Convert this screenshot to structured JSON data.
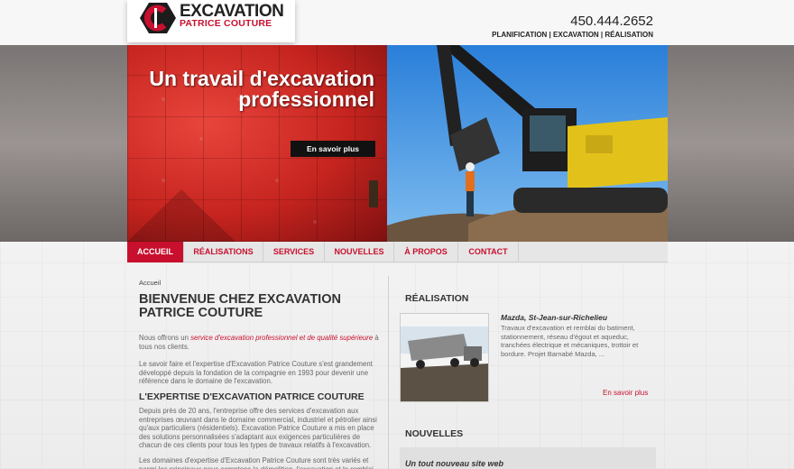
{
  "header": {
    "logo_line1": "EXCAVATION",
    "logo_line2": "PATRICE COUTURE",
    "phone": "450.444.2652",
    "tagline": "PLANIFICATION | EXCAVATION | RÉALISATION"
  },
  "hero": {
    "title": "Un travail d'excavation professionnel",
    "button": "En savoir plus"
  },
  "nav": {
    "items": [
      {
        "label": "ACCUEIL",
        "active": true
      },
      {
        "label": "RÉALISATIONS",
        "active": false
      },
      {
        "label": "SERVICES",
        "active": false
      },
      {
        "label": "NOUVELLES",
        "active": false
      },
      {
        "label": "À PROPOS",
        "active": false
      },
      {
        "label": "CONTACT",
        "active": false
      }
    ]
  },
  "main": {
    "breadcrumb": "Accueil",
    "title": "BIENVENUE CHEZ EXCAVATION PATRICE COUTURE",
    "p1_before": "Nous offrons un ",
    "p1_highlight": "service d'excavation professionnel et de qualité supérieure",
    "p1_after": " à tous nos clients.",
    "p2": "Le savoir faire et l'expertise d'Excavation Patrice Couture s'est grandement développé depuis la fondation de la compagnie en 1993 pour devenir une référence dans le domaine de l'excavation.",
    "subtitle": "L'EXPERTISE D'EXCAVATION PATRICE COUTURE",
    "p3": "Depuis près de 20 ans, l'entreprise offre des services d'excavation aux entreprises œuvrant dans le domaine commercial, industriel et pétrolier ainsi qu'aux particuliers (résidentiels). Excavation Patrice Couture a mis en place des solutions personnalisées s'adaptant aux exigences particulières de chacun de ces clients pour tous les types de travaux relatifs à l'excavation.",
    "p4": "Les domaines d'expertise d'Excavation Patrice Couture sont très variés et parmi les principaux nous comptons la démolition, l'excavation et le remblai"
  },
  "sidebar": {
    "realisation_heading": "RÉALISATION",
    "realisation_title": "Mazda, St-Jean-sur-Richelieu",
    "realisation_desc": "Travaux d'excavation et remblai du batiment, stationnement, réseau d'égout et aqueduc, tranchées électrique et mécaniques, trottoir et bordure. Projet Barnabé Mazda, ...",
    "realisation_more": "En savoir plus",
    "news_heading": "NOUVELLES",
    "news_title": "Un tout nouveau site web"
  },
  "colors": {
    "brand_red": "#c8102e",
    "dark": "#222222"
  }
}
